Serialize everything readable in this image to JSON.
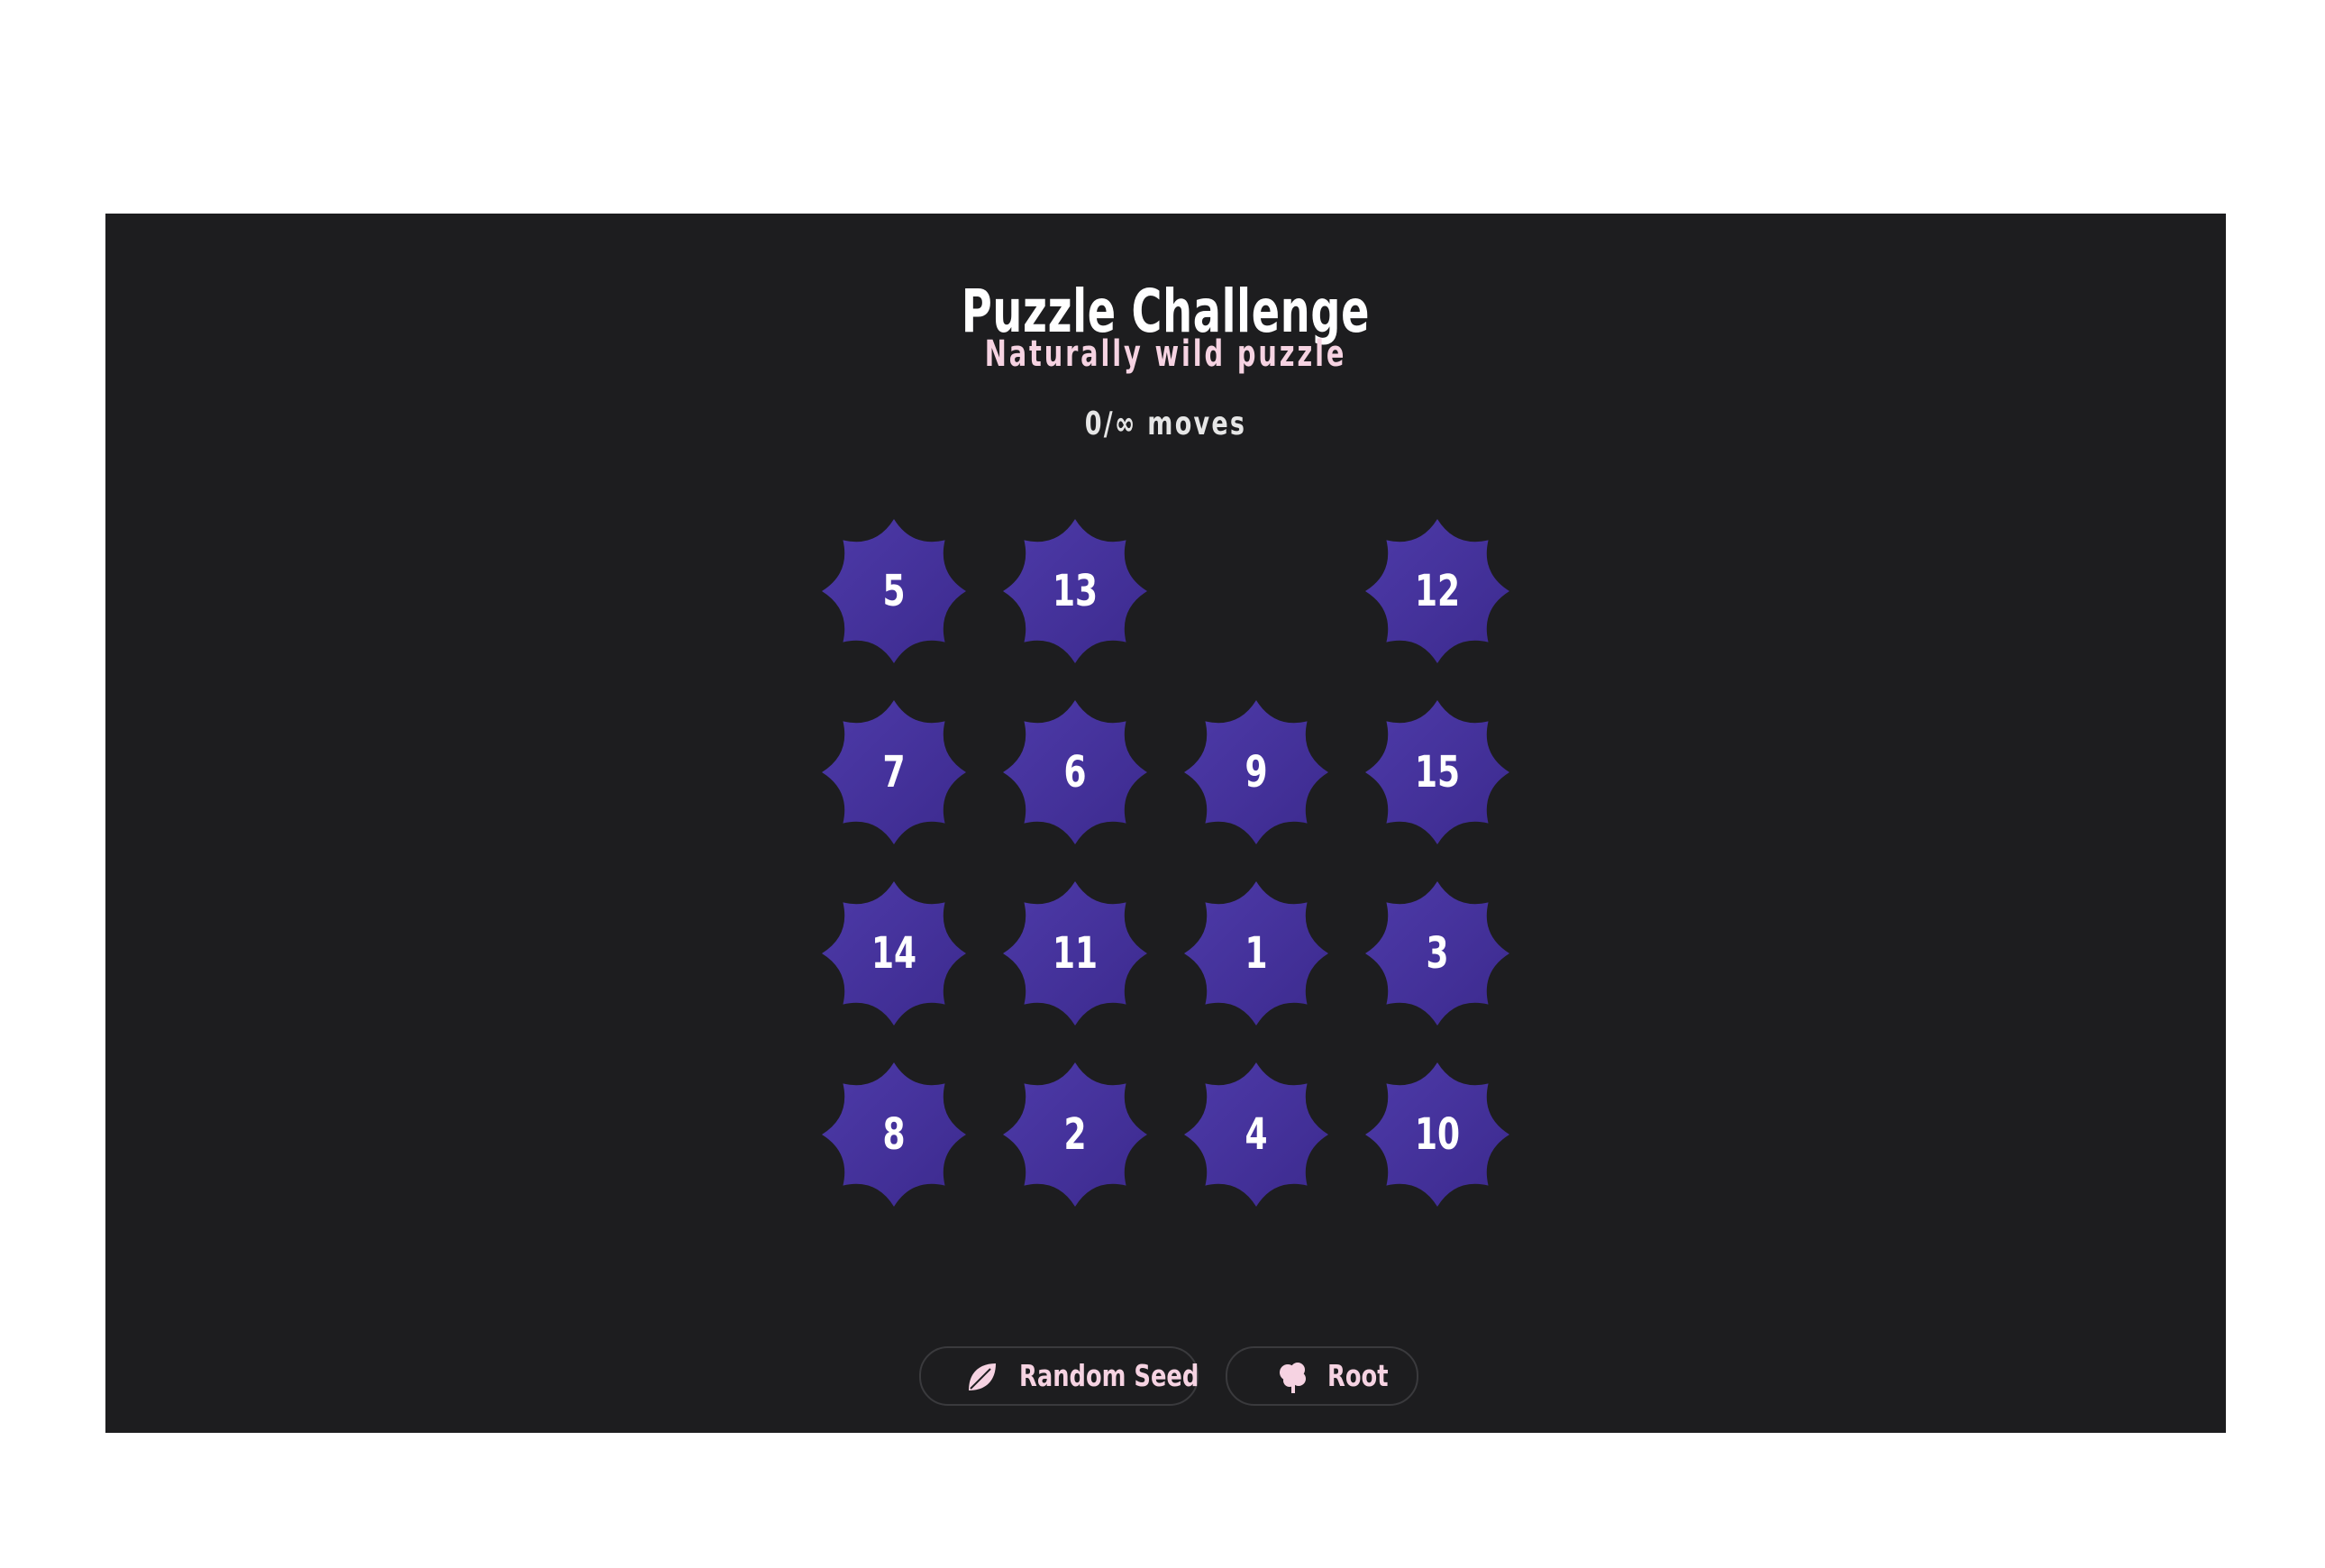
{
  "header": {
    "title": "Puzzle Challenge",
    "subtitle": "Naturally wild puzzle",
    "moves_text": "0/∞ moves"
  },
  "board": {
    "rows": 4,
    "cols": 4,
    "tiles": [
      [
        "5",
        "13",
        "",
        "12"
      ],
      [
        "7",
        "6",
        "9",
        "15"
      ],
      [
        "14",
        "11",
        "1",
        "3"
      ],
      [
        "8",
        "2",
        "4",
        "10"
      ]
    ]
  },
  "controls": {
    "random_seed_label": "Random Seed",
    "root_label": "Root"
  },
  "colors": {
    "background": "#1d1d1f",
    "tile_top": "#4d3aa8",
    "tile_bottom": "#3c2a8e",
    "accent_pink": "#f6d3e2"
  }
}
